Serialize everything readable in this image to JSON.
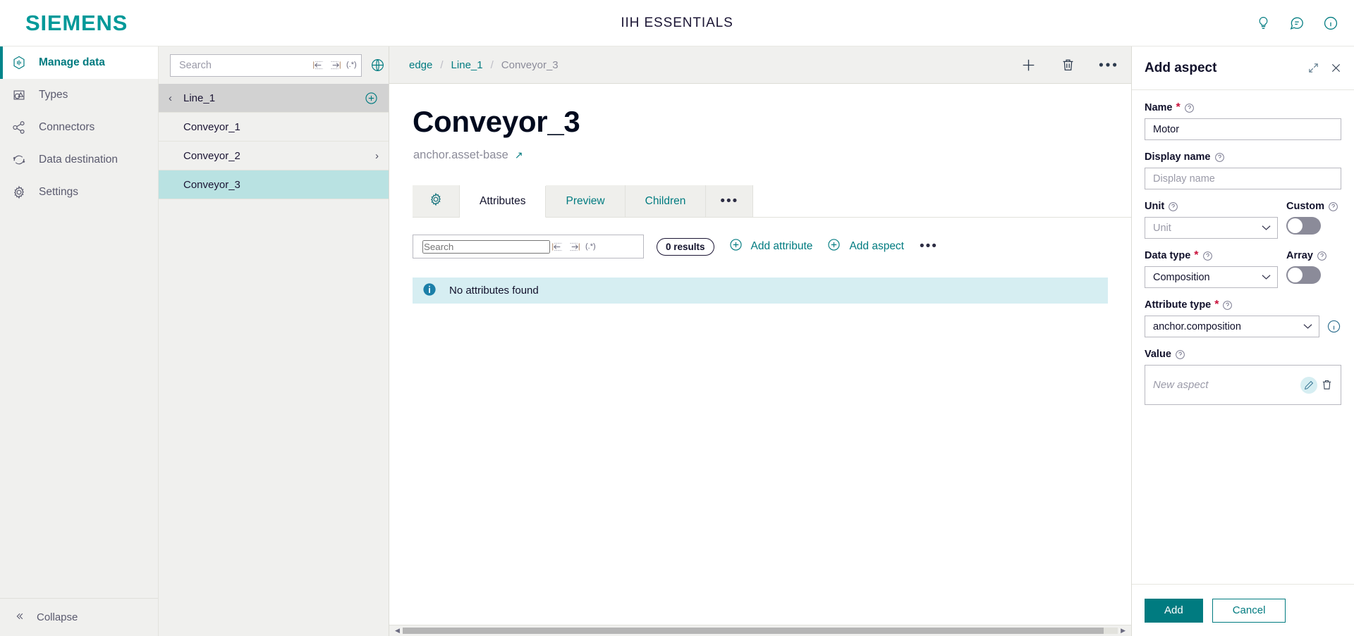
{
  "topbar": {
    "logo": "SIEMENS",
    "app_title": "IIH ESSENTIALS",
    "icons": [
      "bulb-icon",
      "feedback-icon",
      "info-icon"
    ],
    "brand_color": "#009999"
  },
  "sidebar": {
    "items": [
      {
        "label": "Manage data",
        "icon": "hexagon-data-icon",
        "active": true
      },
      {
        "label": "Types",
        "icon": "types-icon",
        "active": false
      },
      {
        "label": "Connectors",
        "icon": "connectors-icon",
        "active": false
      },
      {
        "label": "Data destination",
        "icon": "refresh-icon",
        "active": false
      },
      {
        "label": "Settings",
        "icon": "gear-icon",
        "active": false
      }
    ],
    "collapse_label": "Collapse",
    "active_color": "#007b80"
  },
  "tree": {
    "search": {
      "placeholder": "Search",
      "value": ""
    },
    "search_icons": [
      "match-start-icon",
      "match-end-icon",
      "regex-icon"
    ],
    "globe_icon": "globe-icon",
    "rows": [
      {
        "label": "Line_1",
        "state": "selected-gray",
        "back_chevron": "‹",
        "add_icon": "plus-circle-icon"
      },
      {
        "label": "Conveyor_1",
        "state": "normal"
      },
      {
        "label": "Conveyor_2",
        "state": "normal",
        "chevron": "›"
      },
      {
        "label": "Conveyor_3",
        "state": "selected-teal"
      }
    ]
  },
  "breadcrumb": {
    "items": [
      "edge",
      "Line_1",
      "Conveyor_3"
    ],
    "separator": "/",
    "actions": [
      "add-icon",
      "delete-icon",
      "more-icon"
    ]
  },
  "main": {
    "title": "Conveyor_3",
    "subtitle": "anchor.asset-base",
    "subtitle_arrow": "↗",
    "tabs": [
      {
        "label": "",
        "icon": "gear-icon",
        "active": false
      },
      {
        "label": "Attributes",
        "active": true
      },
      {
        "label": "Preview",
        "active": false
      },
      {
        "label": "Children",
        "active": false
      },
      {
        "label": "•••",
        "active": false
      }
    ],
    "toolbar": {
      "search_placeholder": "Search",
      "search_value": "",
      "search_icons": [
        "match-start-icon",
        "match-end-icon",
        "regex-icon"
      ],
      "results_badge": "0 results",
      "add_attribute_label": "Add attribute",
      "add_aspect_label": "Add aspect",
      "more_label": "•••"
    },
    "banner": {
      "icon": "info-icon",
      "text": "No attributes found"
    }
  },
  "panel": {
    "title": "Add aspect",
    "header_icons": [
      "expand-icon",
      "close-icon"
    ],
    "fields": {
      "name": {
        "label": "Name",
        "required": true,
        "value": "Motor",
        "help": "help-icon"
      },
      "display_name": {
        "label": "Display name",
        "placeholder": "Display name",
        "value": "",
        "help": "help-icon"
      },
      "unit": {
        "label": "Unit",
        "placeholder": "Unit",
        "value": "",
        "help": "help-icon"
      },
      "custom": {
        "label": "Custom",
        "help": "help-icon",
        "enabled": false
      },
      "data_type": {
        "label": "Data type",
        "required": true,
        "value": "Composition",
        "help": "help-icon"
      },
      "array": {
        "label": "Array",
        "help": "help-icon",
        "enabled": false
      },
      "attribute_type": {
        "label": "Attribute type",
        "required": true,
        "value": "anchor.composition",
        "help": "help-icon",
        "info": "info-icon"
      },
      "value": {
        "label": "Value",
        "help": "help-icon",
        "placeholder": "New aspect",
        "icons": [
          "edit-icon",
          "delete-icon"
        ]
      }
    },
    "buttons": {
      "add": "Add",
      "cancel": "Cancel"
    },
    "primary_color": "#007b80"
  }
}
